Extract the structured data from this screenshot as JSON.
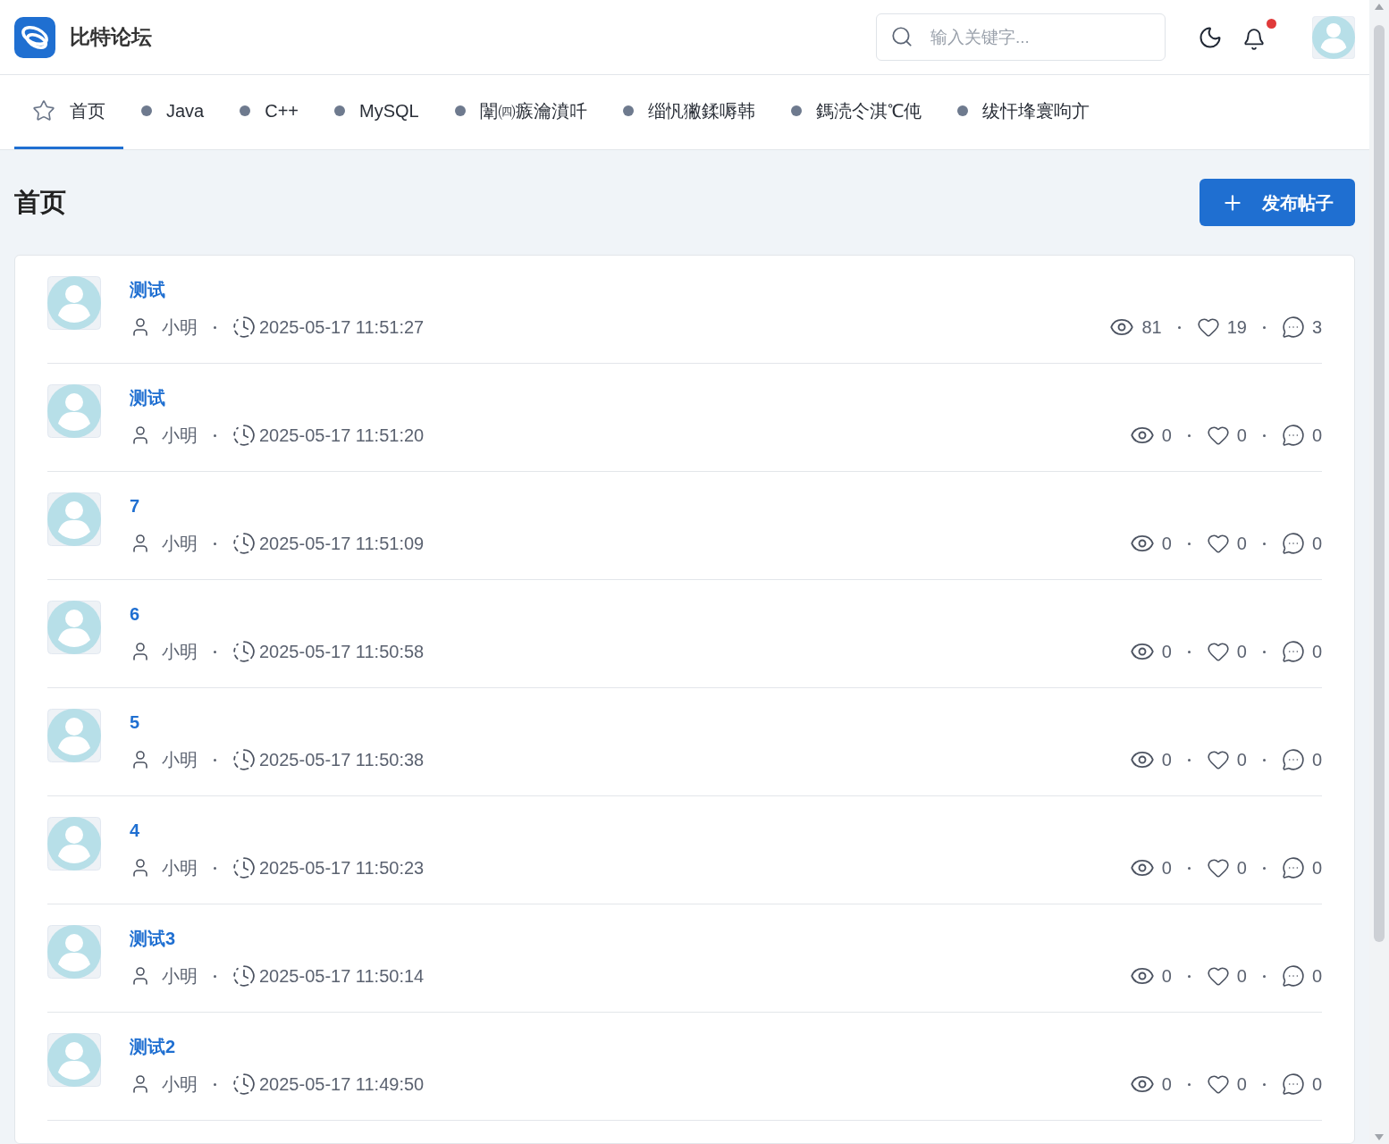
{
  "header": {
    "site_name": "比特论坛",
    "search": {
      "placeholder": "输入关键字..."
    },
    "notifications": {
      "unread": true
    }
  },
  "nav": [
    {
      "label": "首页",
      "kind": "home",
      "selected": true
    },
    {
      "label": "Java",
      "kind": "board",
      "selected": false
    },
    {
      "label": "C++",
      "kind": "board",
      "selected": false
    },
    {
      "label": "MySQL",
      "kind": "board",
      "selected": false
    },
    {
      "label": "闈㈣瘯瀹濆吀",
      "kind": "board",
      "selected": false
    },
    {
      "label": "缁忛獙鍒嗕韩",
      "kind": "board",
      "selected": false
    },
    {
      "label": "鎷涜仒淇℃伅",
      "kind": "board",
      "selected": false
    },
    {
      "label": "绂忓埄寰呴亣",
      "kind": "board",
      "selected": false
    }
  ],
  "page": {
    "title": "首页",
    "new_post_button": "发布帖子"
  },
  "posts": [
    {
      "title": "测试",
      "author": "小明",
      "time": "2025-05-17 11:51:27",
      "views": "81",
      "likes": "19",
      "comments": "3"
    },
    {
      "title": "测试",
      "author": "小明",
      "time": "2025-05-17 11:51:20",
      "views": "0",
      "likes": "0",
      "comments": "0"
    },
    {
      "title": "7",
      "author": "小明",
      "time": "2025-05-17 11:51:09",
      "views": "0",
      "likes": "0",
      "comments": "0"
    },
    {
      "title": "6",
      "author": "小明",
      "time": "2025-05-17 11:50:58",
      "views": "0",
      "likes": "0",
      "comments": "0"
    },
    {
      "title": "5",
      "author": "小明",
      "time": "2025-05-17 11:50:38",
      "views": "0",
      "likes": "0",
      "comments": "0"
    },
    {
      "title": "4",
      "author": "小明",
      "time": "2025-05-17 11:50:23",
      "views": "0",
      "likes": "0",
      "comments": "0"
    },
    {
      "title": "测试3",
      "author": "小明",
      "time": "2025-05-17 11:50:14",
      "views": "0",
      "likes": "0",
      "comments": "0"
    },
    {
      "title": "测试2",
      "author": "小明",
      "time": "2025-05-17 11:49:50",
      "views": "0",
      "likes": "0",
      "comments": "0"
    }
  ]
}
